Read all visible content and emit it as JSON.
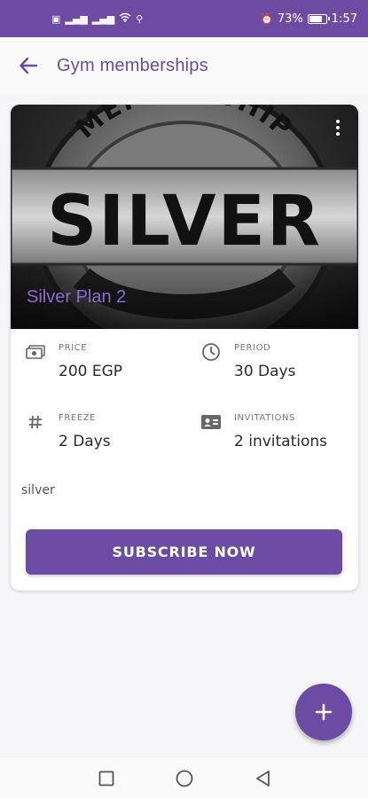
{
  "status_bar": {
    "left_icons": [
      "sim-icon",
      "signal-icon",
      "signal-icon",
      "wifi-icon",
      "usb-icon"
    ],
    "battery_percent": "73%",
    "battery_level": 0.73,
    "time": "1:57"
  },
  "app_bar": {
    "back_icon": "arrow-left-icon",
    "title": "Gym memberships"
  },
  "card": {
    "hero_text_top": "MEMBERSHIP",
    "hero_text_main": "SILVER",
    "plan_name": "Silver Plan 2",
    "more_icon": "more-vertical-icon",
    "details": {
      "price": {
        "label": "PRICE",
        "value": "200 EGP",
        "icon": "money-icon"
      },
      "period": {
        "label": "PERIOD",
        "value": "30 Days",
        "icon": "clock-icon"
      },
      "freeze": {
        "label": "FREEZE",
        "value": "2 Days",
        "icon": "hash-icon"
      },
      "invitations": {
        "label": "INVITATIONS",
        "value": "2 invitations",
        "icon": "id-card-icon"
      }
    },
    "description": "silver",
    "subscribe_label": "SUBSCRIBE NOW"
  },
  "fab": {
    "icon": "plus-icon"
  },
  "nav_bar": {
    "icons": [
      "square-icon",
      "circle-icon",
      "triangle-back-icon"
    ]
  },
  "colors": {
    "primary": "#6b4ba3",
    "plan_name": "#8b6bd0",
    "status_bar": "#6e4ba2"
  }
}
